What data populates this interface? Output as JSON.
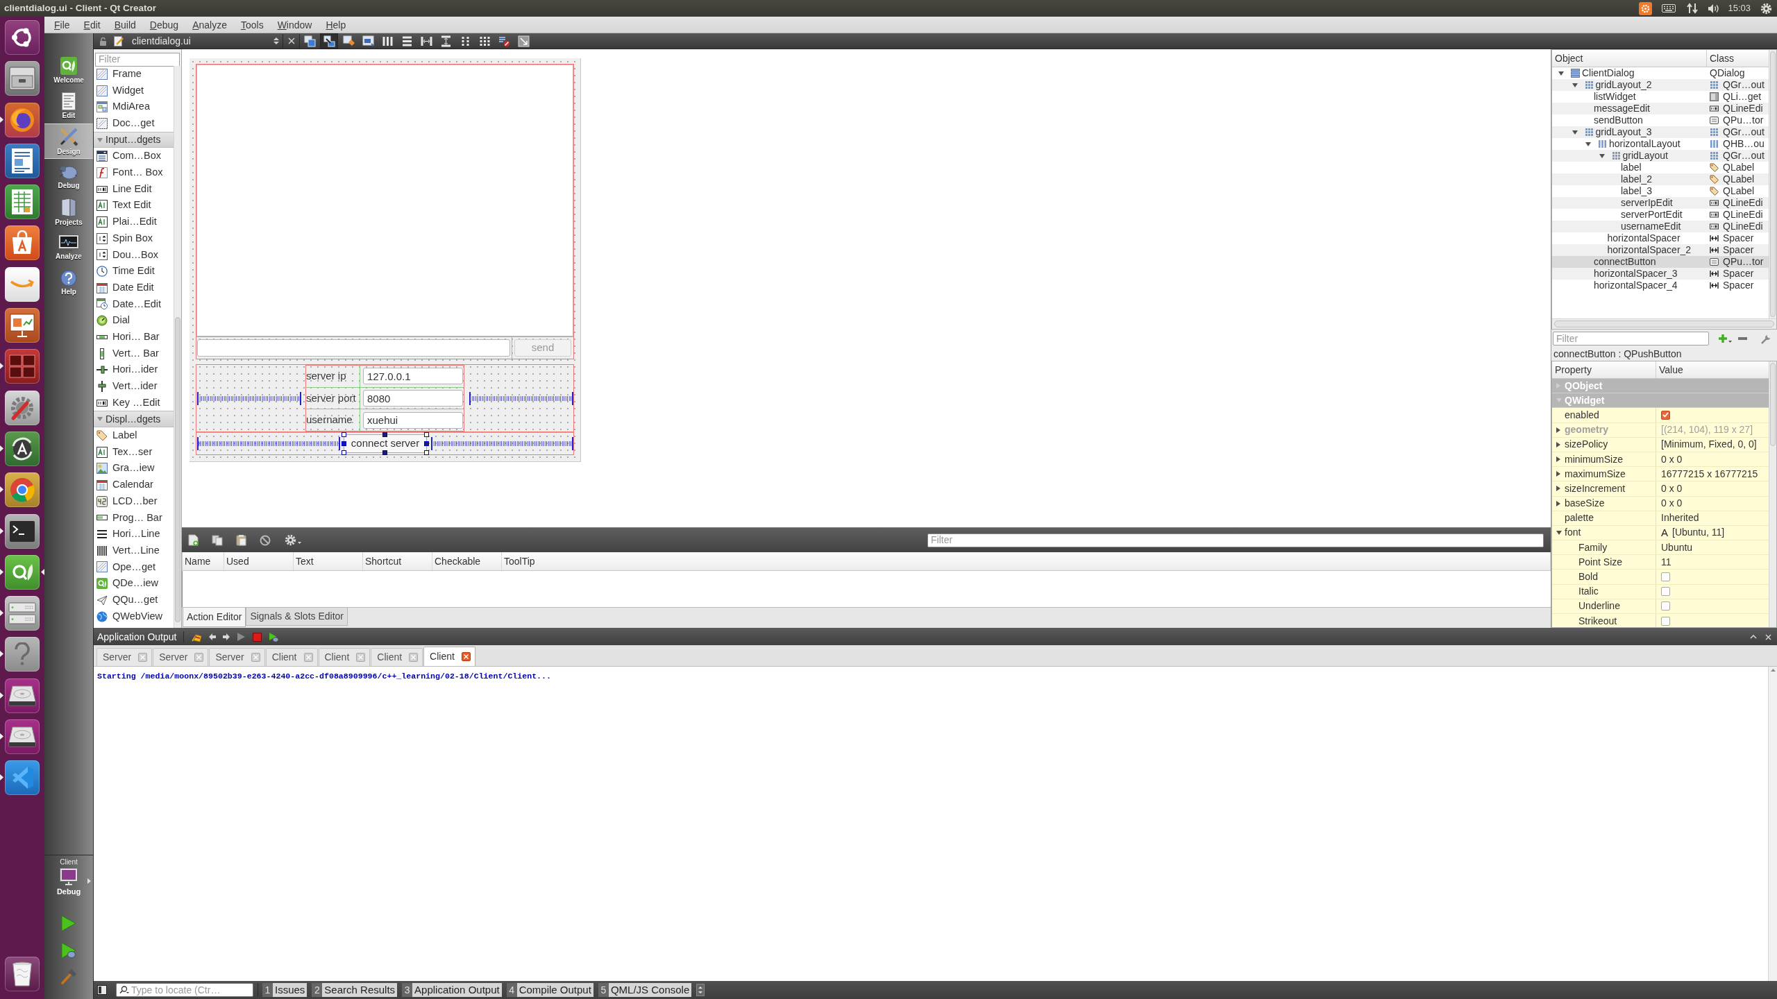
{
  "top_panel": {
    "title": "clientdialog.ui - Client - Qt Creator",
    "clock": "15:03"
  },
  "launcher": [
    {
      "kind": "dash",
      "running": false,
      "focused": false
    },
    {
      "kind": "files",
      "running": false,
      "focused": false
    },
    {
      "kind": "firefox",
      "running": true,
      "focused": false
    },
    {
      "kind": "writer",
      "running": false,
      "focused": false
    },
    {
      "kind": "calc",
      "running": false,
      "focused": false
    },
    {
      "kind": "software",
      "running": false,
      "focused": false
    },
    {
      "kind": "amazon",
      "running": false,
      "focused": false
    },
    {
      "kind": "impress",
      "running": false,
      "focused": false
    },
    {
      "kind": "workspaces",
      "running": true,
      "focused": false
    },
    {
      "kind": "settings",
      "running": false,
      "focused": false
    },
    {
      "kind": "updater",
      "running": true,
      "focused": false
    },
    {
      "kind": "chrome",
      "running": true,
      "focused": false
    },
    {
      "kind": "terminal",
      "running": true,
      "focused": false
    },
    {
      "kind": "qtcreator",
      "running": true,
      "focused": true
    },
    {
      "kind": "server",
      "running": true,
      "focused": false
    },
    {
      "kind": "help",
      "running": true,
      "focused": false
    },
    {
      "kind": "disk",
      "running": true,
      "focused": false
    },
    {
      "kind": "disk",
      "running": true,
      "focused": false
    },
    {
      "kind": "vscode",
      "running": true,
      "focused": false
    },
    {
      "kind": "trash",
      "running": false,
      "focused": false
    }
  ],
  "menu": [
    "File",
    "Edit",
    "Build",
    "Debug",
    "Analyze",
    "Tools",
    "Window",
    "Help"
  ],
  "modes": [
    {
      "label": "Welcome",
      "selected": false
    },
    {
      "label": "Edit",
      "selected": false
    },
    {
      "label": "Design",
      "selected": true
    },
    {
      "label": "Debug",
      "selected": false
    },
    {
      "label": "Projects",
      "selected": false
    },
    {
      "label": "Analyze",
      "selected": false
    },
    {
      "label": "Help",
      "selected": false
    }
  ],
  "kit_selector": {
    "project": "Client",
    "build": "Debug"
  },
  "editor_toolbar": {
    "file": "clientdialog.ui",
    "tools": [
      {
        "kind": "edit-widgets",
        "selected": false
      },
      {
        "kind": "edit-signals",
        "selected": true
      },
      {
        "kind": "edit-buddies",
        "selected": false
      },
      {
        "kind": "edit-tab-order",
        "selected": false
      },
      {
        "kind": "layout-horizontal",
        "selected": false
      },
      {
        "kind": "layout-vertical",
        "selected": false
      },
      {
        "kind": "splitter-horizontal",
        "selected": false
      },
      {
        "kind": "splitter-vertical",
        "selected": false
      },
      {
        "kind": "layout-form",
        "selected": false
      },
      {
        "kind": "layout-grid",
        "selected": false
      },
      {
        "kind": "break-layout",
        "selected": false
      },
      {
        "kind": "adjust-size",
        "selected": false
      }
    ]
  },
  "widget_box": {
    "filter_placeholder": "Filter",
    "groups": [
      {
        "items": [
          {
            "label": "Frame",
            "kind": "hatched"
          },
          {
            "label": "Widget",
            "kind": "hatched"
          },
          {
            "label": "MdiArea",
            "kind": "mdi"
          },
          {
            "label": "Doc…get",
            "kind": "dock"
          }
        ]
      },
      {
        "title": "Input…dgets",
        "expanded": true,
        "items": [
          {
            "label": "Com…Box",
            "kind": "combo"
          },
          {
            "label": "Font… Box",
            "kind": "font"
          },
          {
            "label": "Line Edit",
            "kind": "lineedit"
          },
          {
            "label": "Text Edit",
            "kind": "textedit"
          },
          {
            "label": "Plai…Edit",
            "kind": "textedit"
          },
          {
            "label": "Spin Box",
            "kind": "spin"
          },
          {
            "label": "Dou…Box",
            "kind": "spin"
          },
          {
            "label": "Time Edit",
            "kind": "clock"
          },
          {
            "label": "Date Edit",
            "kind": "calendar"
          },
          {
            "label": "Date…Edit",
            "kind": "calendar-clock"
          },
          {
            "label": "Dial",
            "kind": "dial"
          },
          {
            "label": "Hori… Bar",
            "kind": "hscroll"
          },
          {
            "label": "Vert… Bar",
            "kind": "vscroll"
          },
          {
            "label": "Hori…ider",
            "kind": "hslider"
          },
          {
            "label": "Vert…ider",
            "kind": "vslider"
          },
          {
            "label": "Key …Edit",
            "kind": "lineedit"
          }
        ]
      },
      {
        "title": "Displ…dgets",
        "expanded": true,
        "items": [
          {
            "label": "Label",
            "kind": "label"
          },
          {
            "label": "Tex…ser",
            "kind": "textedit"
          },
          {
            "label": "Gra…iew",
            "kind": "graphics"
          },
          {
            "label": "Calendar",
            "kind": "calendar"
          },
          {
            "label": "LCD…ber",
            "kind": "lcd"
          },
          {
            "label": "Prog… Bar",
            "kind": "progress"
          },
          {
            "label": "Hori…Line",
            "kind": "hline"
          },
          {
            "label": "Vert…Line",
            "kind": "vline"
          },
          {
            "label": "Ope…get",
            "kind": "hatched"
          },
          {
            "label": "QDe…iew",
            "kind": "qt"
          },
          {
            "label": "QQu…get",
            "kind": "quick"
          },
          {
            "label": "QWebView",
            "kind": "globe"
          }
        ]
      }
    ]
  },
  "form": {
    "send_button": {
      "label": "send",
      "disabled": true
    },
    "fields": [
      {
        "label": "server ip",
        "value": "127.0.0.1"
      },
      {
        "label": "server port",
        "value": "8080"
      },
      {
        "label": "username",
        "value": "xuehui"
      }
    ],
    "connect_button": {
      "label": "connect server",
      "selected": true
    }
  },
  "action_editor": {
    "filter_placeholder": "Filter",
    "columns": [
      "Name",
      "Used",
      "Text",
      "Shortcut",
      "Checkable",
      "ToolTip"
    ],
    "tabs": [
      {
        "label": "Action Editor",
        "selected": true
      },
      {
        "label": "Signals & Slots Editor",
        "selected": false
      }
    ]
  },
  "object_inspector": {
    "columns": [
      "Object",
      "Class"
    ],
    "tree": [
      {
        "name": "ClientDialog",
        "class": "QDialog",
        "kind": "dialog",
        "expanded": true,
        "selected": false,
        "children": [
          {
            "name": "gridLayout_2",
            "class": "QGr…out",
            "kind": "grid",
            "expanded": true,
            "selected": false,
            "children": [
              {
                "name": "listWidget",
                "class": "QLi…get",
                "kind": "list",
                "selected": false
              },
              {
                "name": "messageEdit",
                "class": "QLineEdi",
                "kind": "lineedit",
                "selected": false
              },
              {
                "name": "sendButton",
                "class": "QPu…tor",
                "kind": "button",
                "selected": false
              }
            ]
          },
          {
            "name": "gridLayout_3",
            "class": "QGr…out",
            "kind": "grid",
            "expanded": true,
            "selected": false,
            "children": [
              {
                "name": "horizontalLayout",
                "class": "QHB…ou",
                "kind": "hbox",
                "expanded": true,
                "selected": false,
                "children": [
                  {
                    "name": "gridLayout",
                    "class": "QGr…out",
                    "kind": "grid",
                    "expanded": true,
                    "selected": false,
                    "children": [
                      {
                        "name": "label",
                        "class": "QLabel",
                        "kind": "label",
                        "selected": false
                      },
                      {
                        "name": "label_2",
                        "class": "QLabel",
                        "kind": "label",
                        "selected": false
                      },
                      {
                        "name": "label_3",
                        "class": "QLabel",
                        "kind": "label",
                        "selected": false
                      },
                      {
                        "name": "serverIpEdit",
                        "class": "QLineEdi",
                        "kind": "lineedit",
                        "selected": false
                      },
                      {
                        "name": "serverPortEdit",
                        "class": "QLineEdi",
                        "kind": "lineedit",
                        "selected": false
                      },
                      {
                        "name": "usernameEdit",
                        "class": "QLineEdi",
                        "kind": "lineedit",
                        "selected": false
                      }
                    ]
                  },
                  {
                    "name": "horizontalSpacer",
                    "class": "Spacer",
                    "kind": "spacer",
                    "selected": false
                  },
                  {
                    "name": "horizontalSpacer_2",
                    "class": "Spacer",
                    "kind": "spacer",
                    "selected": false
                  }
                ]
              },
              {
                "name": "connectButton",
                "class": "QPu…tor",
                "kind": "button",
                "selected": true
              },
              {
                "name": "horizontalSpacer_3",
                "class": "Spacer",
                "kind": "spacer",
                "selected": false
              },
              {
                "name": "horizontalSpacer_4",
                "class": "Spacer",
                "kind": "spacer",
                "selected": false
              }
            ]
          }
        ]
      }
    ]
  },
  "property_editor": {
    "filter_placeholder": "Filter",
    "selection": "connectButton : QPushButton",
    "columns": [
      "Property",
      "Value"
    ],
    "groups": [
      {
        "name": "QObject",
        "expanded": false
      },
      {
        "name": "QWidget",
        "expanded": true,
        "properties": [
          {
            "name": "enabled",
            "kind": "checkbox",
            "checked": true,
            "disabled": false,
            "modified": false
          },
          {
            "name": "geometry",
            "kind": "text",
            "value": "[(214, 104), 119 x 27]",
            "expanded": false,
            "disabled": true,
            "modified": true
          },
          {
            "name": "sizePolicy",
            "kind": "text",
            "value": "[Minimum, Fixed, 0, 0]",
            "expanded": false,
            "disabled": false,
            "modified": false
          },
          {
            "name": "minimumSize",
            "kind": "text",
            "value": "0 x 0",
            "expanded": false,
            "disabled": false,
            "modified": false
          },
          {
            "name": "maximumSize",
            "kind": "text",
            "value": "16777215 x 16777215",
            "expanded": false,
            "disabled": false,
            "modified": false
          },
          {
            "name": "sizeIncrement",
            "kind": "text",
            "value": "0 x 0",
            "expanded": false,
            "disabled": false,
            "modified": false
          },
          {
            "name": "baseSize",
            "kind": "text",
            "value": "0 x 0",
            "expanded": false,
            "disabled": false,
            "modified": false
          },
          {
            "name": "palette",
            "kind": "text",
            "value": "Inherited",
            "disabled": false,
            "modified": false
          },
          {
            "name": "font",
            "kind": "font",
            "sample": "A",
            "value": "[Ubuntu, 11]",
            "expanded": true,
            "disabled": false,
            "modified": false,
            "children": [
              {
                "name": "Family",
                "kind": "text",
                "value": "Ubuntu"
              },
              {
                "name": "Point Size",
                "kind": "text",
                "value": "11"
              },
              {
                "name": "Bold",
                "kind": "checkbox",
                "checked": false
              },
              {
                "name": "Italic",
                "kind": "checkbox",
                "checked": false
              },
              {
                "name": "Underline",
                "kind": "checkbox",
                "checked": false
              },
              {
                "name": "Strikeout",
                "kind": "checkbox",
                "checked": false
              }
            ]
          }
        ]
      }
    ]
  },
  "app_output": {
    "title": "Application Output",
    "controls": [
      {
        "kind": "clear",
        "disabled": false
      },
      {
        "kind": "previous",
        "disabled": false
      },
      {
        "kind": "next",
        "disabled": false
      },
      {
        "kind": "run",
        "disabled": true
      },
      {
        "kind": "stop",
        "disabled": false
      },
      {
        "kind": "debug-run",
        "disabled": false
      }
    ],
    "tabs": [
      {
        "label": "Server",
        "selected": false
      },
      {
        "label": "Server",
        "selected": false
      },
      {
        "label": "Server",
        "selected": false
      },
      {
        "label": "Client",
        "selected": false
      },
      {
        "label": "Client",
        "selected": false
      },
      {
        "label": "Client",
        "selected": false
      },
      {
        "label": "Client",
        "selected": true
      }
    ],
    "lines": [
      "Starting /media/moonx/89502b39-e263-4240-a2cc-df08a8909996/c++_learning/02-18/Client/Client..."
    ]
  },
  "status_bar": {
    "locate_placeholder": "Type to locate (Ctr…",
    "panes": [
      {
        "number": "1",
        "label": "Issues"
      },
      {
        "number": "2",
        "label": "Search Results"
      },
      {
        "number": "3",
        "label": "Application Output"
      },
      {
        "number": "4",
        "label": "Compile Output"
      },
      {
        "number": "5",
        "label": "QML/JS Console"
      }
    ]
  }
}
